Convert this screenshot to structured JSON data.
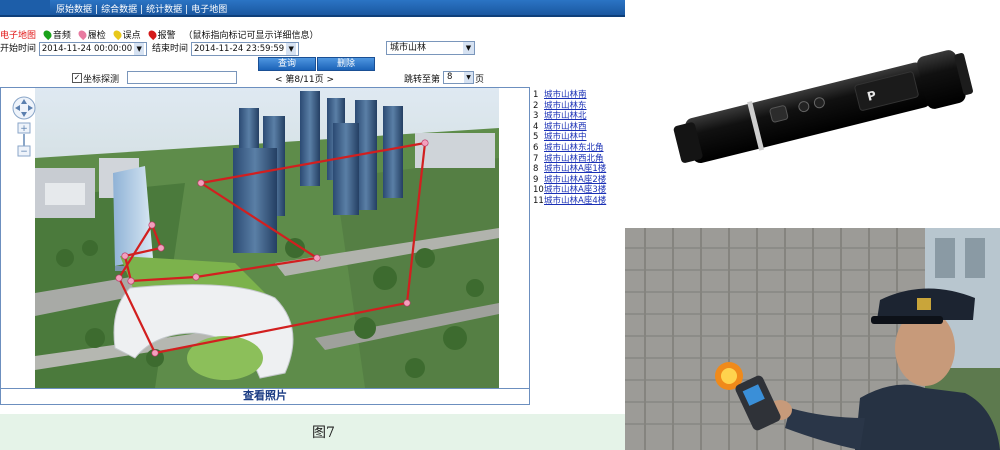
{
  "nav": {
    "tabs": [
      "原始数据",
      "综合数据",
      "统计数据",
      "电子地图"
    ],
    "separator": "|"
  },
  "legend": {
    "map_label": "电子地图",
    "items": [
      {
        "label": "音频",
        "icon": "green-marker-icon",
        "color": "#1aa21a"
      },
      {
        "label": "履检",
        "icon": "pink-marker-icon",
        "color": "#e87aa0"
      },
      {
        "label": "误点",
        "icon": "yellow-marker-icon",
        "color": "#e8c81a"
      },
      {
        "label": "报警",
        "icon": "red-marker-icon",
        "color": "#d41a1a"
      }
    ],
    "hint": "（鼠标指向标记可显示详细信息）"
  },
  "filters": {
    "start_label": "开始时间",
    "start_value": "2014-11-24 00:00:00",
    "end_label": "结束时间",
    "end_value": "2014-11-24 23:59:59",
    "area_value": "城市山林"
  },
  "buttons": {
    "query": "查询",
    "delete": "删除"
  },
  "coord": {
    "checkbox_mark": "✓",
    "label": "坐标探测",
    "prev": "<",
    "page_text": "第8/11页",
    "next": ">",
    "jump_label": "跳转至第",
    "jump_value": "8",
    "page_unit": "页"
  },
  "points": [
    {
      "no": "1",
      "name": "城市山林南"
    },
    {
      "no": "2",
      "name": "城市山林东"
    },
    {
      "no": "3",
      "name": "城市山林北"
    },
    {
      "no": "4",
      "name": "城市山林西"
    },
    {
      "no": "5",
      "name": "城市山林中"
    },
    {
      "no": "6",
      "name": "城市山林东北角"
    },
    {
      "no": "7",
      "name": "城市山林西北角"
    },
    {
      "no": "8",
      "name": "城市山林A座1楼"
    },
    {
      "no": "9",
      "name": "城市山林A座2楼"
    },
    {
      "no": "10",
      "name": "城市山林A座3楼"
    },
    {
      "no": "11",
      "name": "城市山林A座4楼"
    }
  ],
  "view_photo": "查看照片",
  "caption": "图7",
  "route_color": "#d21f1f",
  "accent": "#1a57a0"
}
